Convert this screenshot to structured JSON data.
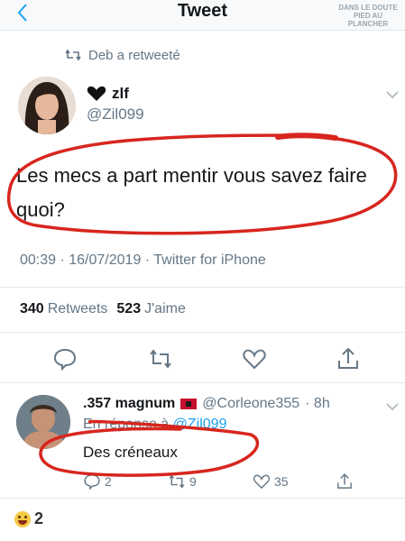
{
  "header": {
    "title": "Tweet",
    "watermark_line1": "DANS LE DOUTE",
    "watermark_line2": "PIED AU PLANCHER"
  },
  "retweet": {
    "label": "Deb a retweeté"
  },
  "tweet": {
    "name": "zlf",
    "handle": "@Zil099",
    "text": "Les mecs a part mentir vous savez faire quoi?",
    "meta": "00:39 · 16/07/2019 · Twitter for iPhone",
    "retweets_count": "340",
    "retweets_label": "Retweets",
    "likes_count": "523",
    "likes_label": "J'aime"
  },
  "reply": {
    "name": ".357 magnum",
    "handle": "@Corleone355",
    "time": "· 8h",
    "reply_to_prefix": "En réponse à",
    "reply_to_handle": "@Zil099",
    "text": "Des créneaux",
    "reply_count": "2",
    "retweet_count": "9",
    "like_count": "35"
  },
  "footer": {
    "reaction_count": "2"
  },
  "colors": {
    "accent": "#1da1f2",
    "annotation": "#d7261e",
    "muted": "#657786"
  },
  "icons": [
    "back-chevron-icon",
    "retweet-icon",
    "black-heart-emoji",
    "caret-down-icon",
    "reply-icon",
    "like-icon",
    "share-icon",
    "flag-icon",
    "laughing-emoji"
  ]
}
